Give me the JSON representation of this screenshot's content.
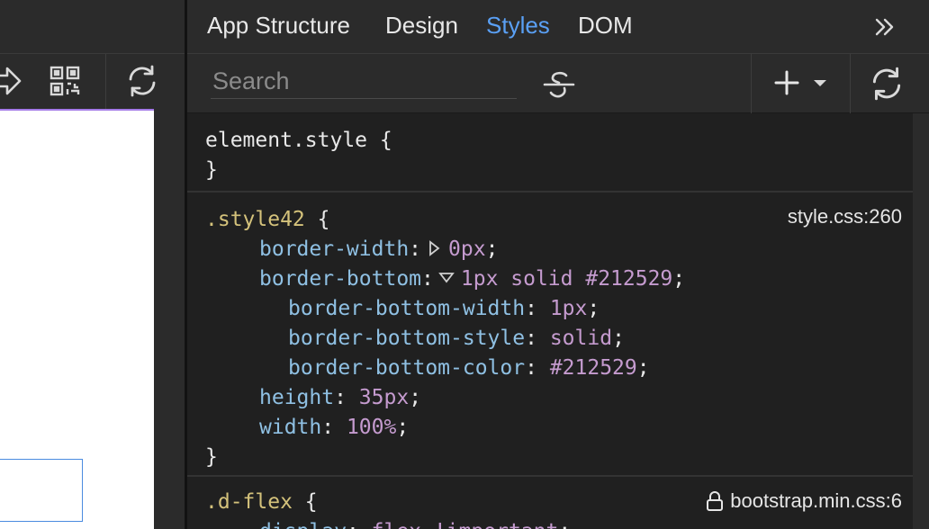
{
  "tabs": [
    {
      "label": "App Structure",
      "active": false
    },
    {
      "label": "Design",
      "active": false
    },
    {
      "label": "Styles",
      "active": true
    },
    {
      "label": "DOM",
      "active": false
    }
  ],
  "toolbar": {
    "search_placeholder": "Search",
    "icons": [
      "share-icon",
      "qr-code-icon",
      "refresh-icon",
      "strikethrough-icon",
      "add-icon",
      "chevron-down-icon",
      "overflow-chevrons-icon"
    ]
  },
  "rules": {
    "element_style": {
      "selector": "element.style",
      "open": "{",
      "close": "}"
    },
    "style42": {
      "selector": ".style42",
      "open": "{",
      "close": "}",
      "source": "style.css:260",
      "decls": [
        {
          "prop": "border-width",
          "value": "0px"
        },
        {
          "prop": "border-bottom",
          "value": "1px solid #212529"
        },
        {
          "prop": "border-bottom-width",
          "value": "1px"
        },
        {
          "prop": "border-bottom-style",
          "value": "solid"
        },
        {
          "prop": "border-bottom-color",
          "value": "#212529"
        },
        {
          "prop": "height",
          "value": "35px"
        },
        {
          "prop": "width",
          "value": "100%"
        }
      ]
    },
    "dflex": {
      "selector": ".d-flex",
      "open": "{",
      "source": "bootstrap.min.css:6",
      "decls": [
        {
          "prop": "display",
          "value": "flex !important"
        }
      ]
    }
  },
  "colors": {
    "accent": "#5aa0f5",
    "selection_border": "#a57be8",
    "property": "#8fc0e3",
    "value": "#c59bcf",
    "class_selector": "#d4c27b"
  }
}
